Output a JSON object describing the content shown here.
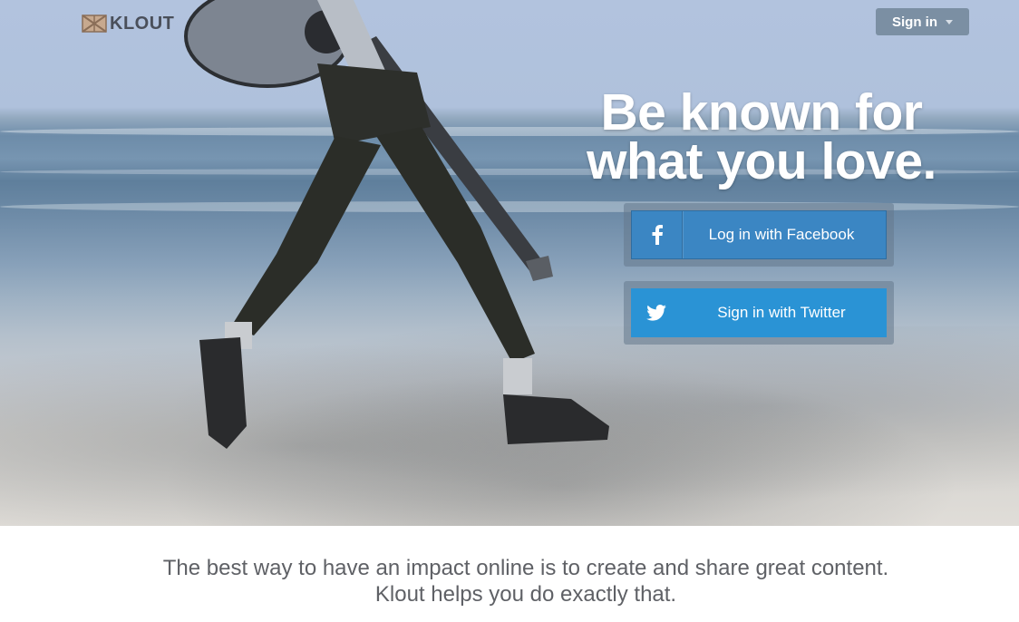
{
  "brand": {
    "name": "KLOUT",
    "logo_icon": "klout-mark-icon"
  },
  "header": {
    "signin_label": "Sign in",
    "signin_caret_icon": "caret-down-icon"
  },
  "hero": {
    "headline_line1": "Be known for",
    "headline_line2": "what you love.",
    "image_description_icon": "hero-photo-icon",
    "facebook_button": {
      "label": "Log in with Facebook",
      "icon": "facebook-icon",
      "color": "#3b86c3"
    },
    "twitter_button": {
      "label": "Sign in with Twitter",
      "icon": "twitter-icon",
      "color": "#2a93d5"
    }
  },
  "footer": {
    "tagline_line1": "The best way to have an impact online is to create and share great content.",
    "tagline_line2": "Klout helps you do exactly that."
  }
}
